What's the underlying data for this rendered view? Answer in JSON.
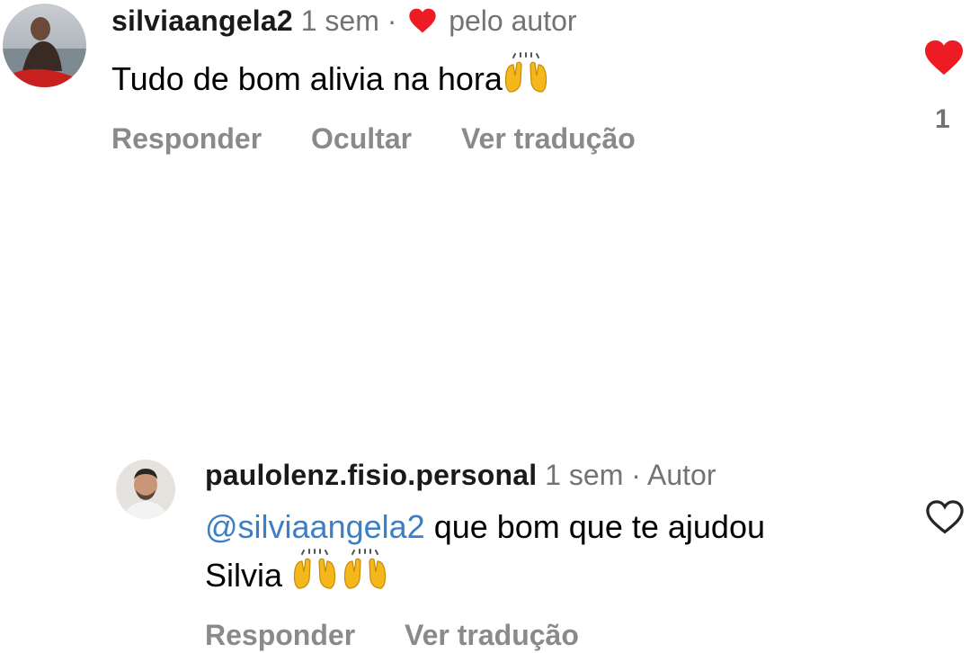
{
  "comments": [
    {
      "username": "silviaangela2",
      "time": "1 sem",
      "separator": "·",
      "by_author": "pelo autor",
      "text": "Tudo de bom alivia na hora",
      "emoji_name": "raising-hands-icon",
      "actions": [
        "Responder",
        "Ocultar",
        "Ver tradução"
      ],
      "liked": true,
      "like_count": "1",
      "like_color": "#ed1c24"
    },
    {
      "username": "paulolenz.fisio.personal",
      "time": "1 sem",
      "separator": "·",
      "author_tag": "Autor",
      "mention": "@silviaangela2",
      "text": " que bom que te ajudou Silvia ",
      "emoji_name": "raising-hands-icon",
      "actions": [
        "Responder",
        "Ver tradução"
      ],
      "liked": false
    }
  ],
  "colors": {
    "mention": "#3b7fc4",
    "secondary_text": "#737373",
    "action_text": "#8a8a8a"
  }
}
